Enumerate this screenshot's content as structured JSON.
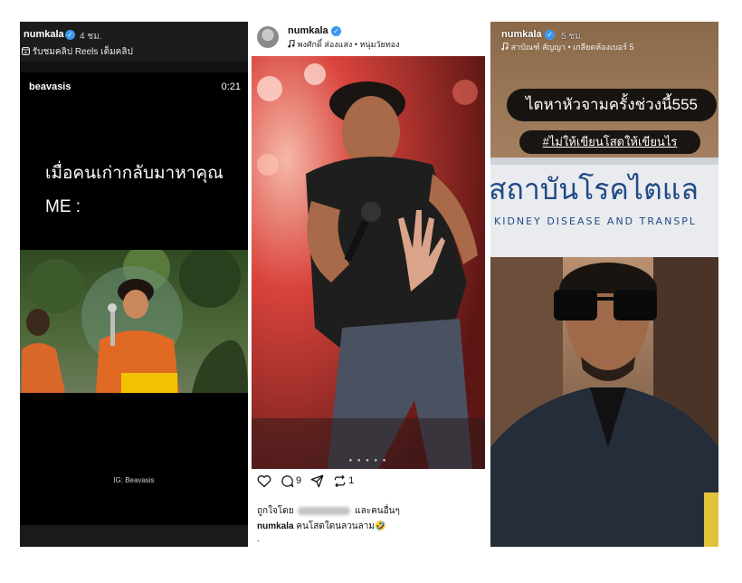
{
  "panel1": {
    "username": "numkala",
    "time": "4 ชม.",
    "subtitle": "รับชมคลิป Reels เต็มคลิป",
    "video": {
      "account": "beavasis",
      "duration": "0:21",
      "caption_line1": "เมื่อคนเก่ากลับมาหาคุณ",
      "caption_line2": "ME :",
      "watermark": "IG: Beavasis"
    }
  },
  "panel2": {
    "username": "numkala",
    "music": "พงศักดิ์ ส่องแสง • หนุ่มวัยทอง",
    "counts": {
      "comments": "9",
      "reposts": "1"
    },
    "liked_prefix": "ถูกใจโดย",
    "liked_suffix": "และคนอื่นๆ",
    "caption_user": "numkala",
    "caption_text": "คนโสดใดนลวนลาม🤣",
    "more": "."
  },
  "panel3": {
    "username": "numkala",
    "time": "5 ชม.",
    "location": "สาบัณฑ์ สัญญา • เกลียดห้องเบอร์ 5",
    "sticker1": "ไตหาหัวจามครั้งช่วงนี้555",
    "sticker2": "#ไม่ให้เขียนโสดให้เขียนไร",
    "sign_thai": "สถาบันโรคไตแล",
    "sign_en": "KIDNEY DISEASE AND TRANSPL"
  },
  "colors": {
    "verified": "#3897f0",
    "story_bg": "#121212",
    "caption_pill": "#0c0c0c",
    "stage_red": "#d8433c"
  },
  "icons": [
    "verified-badge-icon",
    "reels-icon",
    "music-note-icon",
    "heart-icon",
    "comment-icon",
    "share-icon",
    "repost-icon"
  ]
}
